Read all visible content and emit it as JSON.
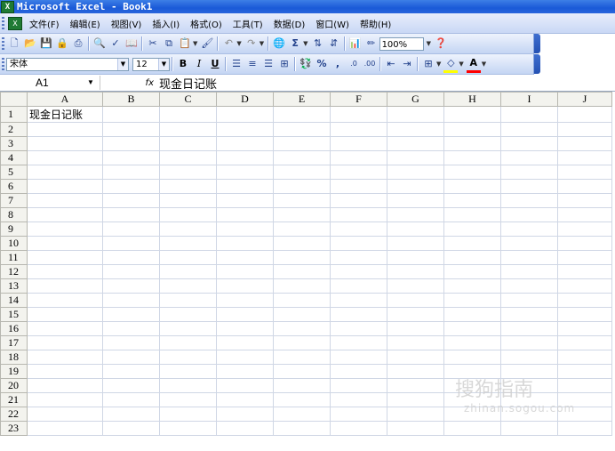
{
  "window": {
    "title": "Microsoft Excel - Book1"
  },
  "menu": {
    "items": [
      "文件(F)",
      "编辑(E)",
      "视图(V)",
      "插入(I)",
      "格式(O)",
      "工具(T)",
      "数据(D)",
      "窗口(W)",
      "帮助(H)"
    ]
  },
  "toolbar": {
    "zoom": "100%",
    "font_name": "宋体",
    "font_size": "12",
    "standard_icons": [
      "new-icon",
      "open-icon",
      "save-icon",
      "permission-icon",
      "print-icon",
      "print-preview-icon",
      "spelling-icon",
      "research-icon",
      "cut-icon",
      "copy-icon",
      "paste-icon",
      "format-painter-icon",
      "undo-icon",
      "redo-icon",
      "hyperlink-icon",
      "autosum-icon",
      "sort-ascending-icon",
      "sort-descending-icon",
      "chart-wizard-icon",
      "drawing-icon",
      "help-icon"
    ],
    "format_icons": [
      "bold-icon",
      "italic-icon",
      "underline-icon",
      "align-left-icon",
      "align-center-icon",
      "align-right-icon",
      "merge-center-icon",
      "currency-icon",
      "percent-icon",
      "comma-icon",
      "increase-decimal-icon",
      "decrease-decimal-icon",
      "decrease-indent-icon",
      "increase-indent-icon",
      "borders-icon",
      "fill-color-icon",
      "font-color-icon"
    ],
    "labels": {
      "bold": "B",
      "italic": "I",
      "underline": "U",
      "percent": "%",
      "comma": ",",
      "autosum": "Σ"
    }
  },
  "formula_bar": {
    "name_box": "A1",
    "fx": "fx",
    "content": "现金日记账"
  },
  "sheet": {
    "columns": [
      "A",
      "B",
      "C",
      "D",
      "E",
      "F",
      "G",
      "H",
      "I",
      "J"
    ],
    "rows": [
      "1",
      "2",
      "3",
      "4",
      "5",
      "6",
      "7",
      "8",
      "9",
      "10",
      "11",
      "12",
      "13",
      "14",
      "15",
      "16",
      "17",
      "18",
      "19",
      "20",
      "21",
      "22",
      "23"
    ],
    "cells": {
      "A1": "现金日记账"
    }
  },
  "watermark": {
    "text": "搜狗指南",
    "url": "zhinan.sogou.com"
  }
}
